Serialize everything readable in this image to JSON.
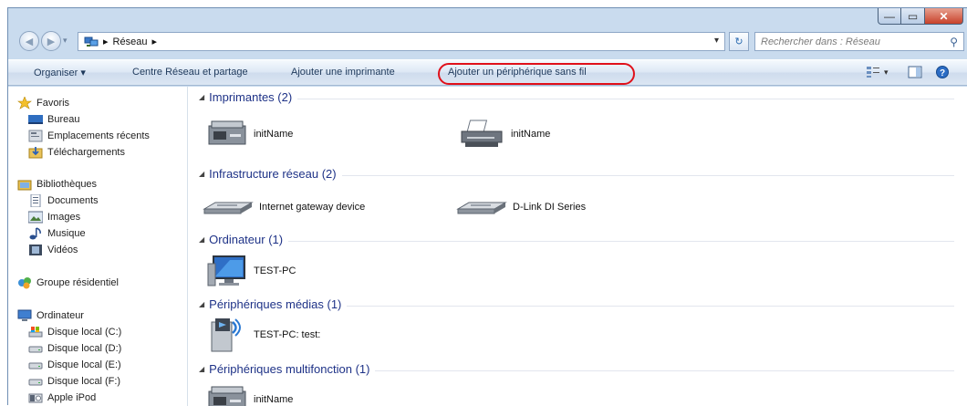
{
  "window": {
    "controls": {
      "minimize": "—",
      "maximize": "▭",
      "close": "✕"
    }
  },
  "address": {
    "crumb_separator": "▸",
    "location": "Réseau",
    "dropdown_glyph": "▾",
    "refresh_glyph": "↻"
  },
  "search": {
    "placeholder": "Rechercher dans : Réseau"
  },
  "toolbar": {
    "organiser": "Organiser ▾",
    "network_center": "Centre Réseau et partage",
    "add_printer": "Ajouter une imprimante",
    "add_wireless": "Ajouter un périphérique sans fil",
    "highlight_color": "#e0101a"
  },
  "sidebar": {
    "favorites": {
      "label": "Favoris",
      "items": [
        "Bureau",
        "Emplacements récents",
        "Téléchargements"
      ]
    },
    "libraries": {
      "label": "Bibliothèques",
      "items": [
        "Documents",
        "Images",
        "Musique",
        "Vidéos"
      ]
    },
    "homegroup": "Groupe résidentiel",
    "computer": {
      "label": "Ordinateur",
      "items": [
        "Disque local (C:)",
        "Disque local (D:)",
        "Disque local (E:)",
        "Disque local (F:)",
        "Apple iPod"
      ]
    }
  },
  "groups": [
    {
      "title": "Imprimantes (2)",
      "devices": [
        "initName",
        "initName"
      ]
    },
    {
      "title": "Infrastructure réseau (2)",
      "devices": [
        "Internet gateway device",
        "D-Link DI Series"
      ]
    },
    {
      "title": "Ordinateur (1)",
      "devices": [
        "TEST-PC"
      ]
    },
    {
      "title": "Périphériques médias (1)",
      "devices": [
        "TEST-PC: test:"
      ]
    },
    {
      "title": "Périphériques multifonction (1)",
      "devices": [
        "initName"
      ]
    }
  ],
  "colors": {
    "group_title": "#1e3287",
    "toolbar_text": "#1e395b",
    "window_frame": "#c9dbee"
  }
}
